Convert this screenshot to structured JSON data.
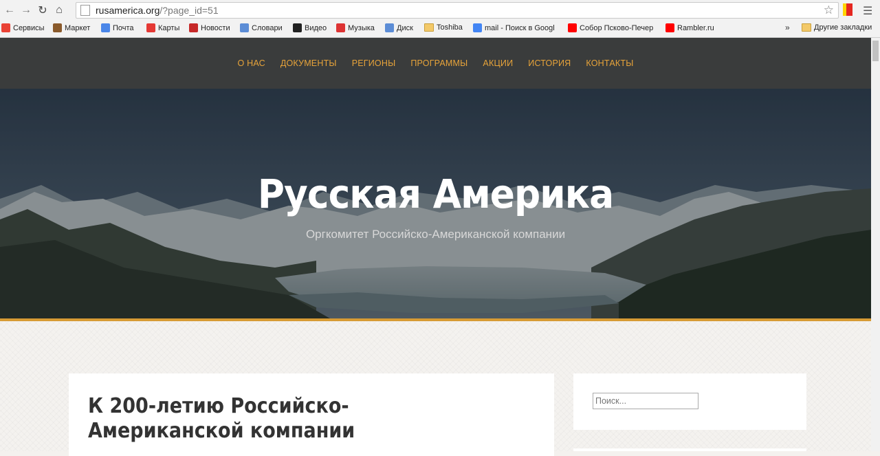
{
  "browser": {
    "url_host": "rusamerica.org",
    "url_path": "/?page_id=51",
    "bookmarks": [
      {
        "label": "Сервисы",
        "icon": "apps-icon",
        "color": "#e94235"
      },
      {
        "label": "Маркет",
        "icon": "market-icon",
        "color": "#8a5a2b"
      },
      {
        "label": "Почта",
        "icon": "mail-icon",
        "color": "#4a86e8"
      },
      {
        "label": "Карты",
        "icon": "maps-icon",
        "color": "#e53935"
      },
      {
        "label": "Новости",
        "icon": "news-icon",
        "color": "#c62828"
      },
      {
        "label": "Словари",
        "icon": "dictionary-icon",
        "color": "#5c8dd6"
      },
      {
        "label": "Видео",
        "icon": "video-icon",
        "color": "#222222"
      },
      {
        "label": "Музыка",
        "icon": "music-icon",
        "color": "#d33"
      },
      {
        "label": "Диск",
        "icon": "disk-icon",
        "color": "#5c8dd6"
      },
      {
        "label": "Toshiba",
        "icon": "folder-icon",
        "color": "#f3c969"
      },
      {
        "label": "mail - Поиск в Googl",
        "icon": "google-icon",
        "color": "#4285f4"
      },
      {
        "label": "Собор Псково-Печер",
        "icon": "yandex-icon",
        "color": "#ff0000"
      },
      {
        "label": "Rambler.ru",
        "icon": "yandex-icon",
        "color": "#ff0000"
      }
    ],
    "more_bookmarks": "»",
    "other_bookmarks": "Другие закладки"
  },
  "nav": {
    "items": [
      "О НАС",
      "ДОКУМЕНТЫ",
      "РЕГИОНЫ",
      "ПРОГРАММЫ",
      "АКЦИИ",
      "ИСТОРИЯ",
      "КОНТАКТЫ"
    ],
    "link_color": "#e8a43a"
  },
  "hero": {
    "title": "Русская Америка",
    "subtitle": "Оргкомитет Российско-Американской компании",
    "accent": "#d79b34"
  },
  "article": {
    "title": "К 200-летию Российско-Американской компании"
  },
  "sidebar": {
    "search_placeholder": "Поиск..."
  }
}
